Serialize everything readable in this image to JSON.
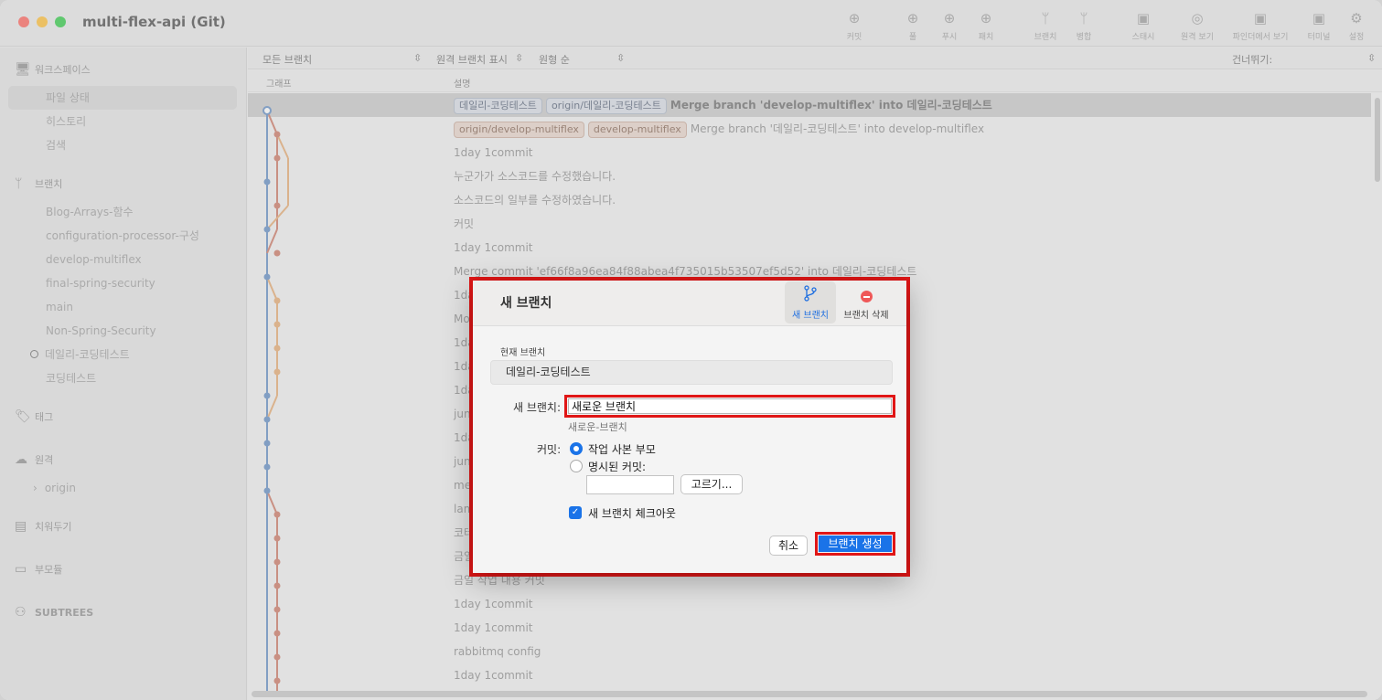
{
  "window": {
    "title": "multi-flex-api (Git)"
  },
  "toolbar": [
    {
      "label": "커밋",
      "icon": "⊕"
    },
    {
      "label": "풀",
      "icon": "⊕"
    },
    {
      "label": "푸시",
      "icon": "⊕"
    },
    {
      "label": "패치",
      "icon": "⊕"
    },
    {
      "label": "브랜치",
      "icon": "ᛘ"
    },
    {
      "label": "병합",
      "icon": "ᛘ"
    },
    {
      "label": "스태시",
      "icon": "▣"
    },
    {
      "label": "원격 보기",
      "icon": "◎"
    },
    {
      "label": "파인더에서 보기",
      "icon": "▣"
    },
    {
      "label": "터미널",
      "icon": "▣"
    },
    {
      "label": "설정",
      "icon": "⚙"
    }
  ],
  "sidebar": {
    "workspace": {
      "title": "워크스페이스",
      "items": [
        "파일 상태",
        "히스토리",
        "검색"
      ]
    },
    "branches": {
      "title": "브랜치",
      "items": [
        "Blog-Arrays-함수",
        "configuration-processor-구성",
        "develop-multiflex",
        "final-spring-security",
        "main",
        "Non-Spring-Security",
        "데일리-코딩테스트",
        "코딩테스트"
      ]
    },
    "tags_title": "태그",
    "remotes": {
      "title": "원격",
      "items": [
        "origin"
      ]
    },
    "stashes_title": "치워두기",
    "submodules_title": "부모듈",
    "subtrees_title": "SUBTREES"
  },
  "filters": {
    "all_branches": "모든 브랜치",
    "show_remote": "원격 브랜치 표시",
    "order": "원형 순",
    "jump_to": "건너뛰기:"
  },
  "columns": {
    "graph": "그래프",
    "description": "설명"
  },
  "commits": [
    {
      "tags": [
        {
          "label": "데일리-코딩테스트",
          "style": "blue"
        },
        {
          "label": "origin/데일리-코딩테스트",
          "style": "blue"
        }
      ],
      "message": "Merge branch 'develop-multiflex' into 데일리-코딩테스트",
      "bold": true
    },
    {
      "tags": [
        {
          "label": "origin/develop-multiflex",
          "style": "orange"
        },
        {
          "label": "develop-multiflex",
          "style": "orange"
        }
      ],
      "message": "Merge branch '데일리-코딩테스트' into develop-multiflex"
    },
    {
      "message": "1day 1commit"
    },
    {
      "message": "누군가가 소스코드를 수정했습니다."
    },
    {
      "message": "소스코드의 일부를 수정하였습니다."
    },
    {
      "message": "커밋"
    },
    {
      "message": "1day 1commit"
    },
    {
      "message": "Merge commit 'ef66f8a96ea84f88abea4f735015b53507ef5d52' into 데일리-코딩테스트"
    },
    {
      "message": "1da"
    },
    {
      "message": "Mo"
    },
    {
      "message": "1da"
    },
    {
      "message": "1da"
    },
    {
      "message": "1da"
    },
    {
      "message": "jun"
    },
    {
      "message": "1da"
    },
    {
      "message": "jun"
    },
    {
      "message": "me"
    },
    {
      "message": "lam"
    },
    {
      "message": "코테"
    },
    {
      "message": "금일"
    },
    {
      "message": "금일 작업 내용 커밋"
    },
    {
      "message": "1day 1commit"
    },
    {
      "message": "1day 1commit"
    },
    {
      "message": "rabbitmq config"
    },
    {
      "message": "1day 1commit"
    }
  ],
  "dialog": {
    "title": "새 브랜치",
    "tab_new": "새 브랜치",
    "tab_delete": "브랜치 삭제",
    "current_branch_label": "현재 브랜치",
    "current_branch_value": "데일리-코딩테스트",
    "new_branch_label": "새 브랜치:",
    "new_branch_value": "새로운 브랜치",
    "new_branch_hint": "새로운-브랜치",
    "commit_label": "커밋:",
    "option_working_copy": "작업 사본 부모",
    "option_specified": "명시된 커밋:",
    "choose_button": "고르기...",
    "checkout_label": "새 브랜치 체크아웃",
    "cancel_button": "취소",
    "create_button": "브랜치 생성"
  },
  "colors": {
    "accent": "#1a73e8",
    "highlight": "#e01616",
    "graph_blue": "#5b87c0",
    "graph_red": "#c9725e",
    "graph_orange": "#e3a66c"
  }
}
